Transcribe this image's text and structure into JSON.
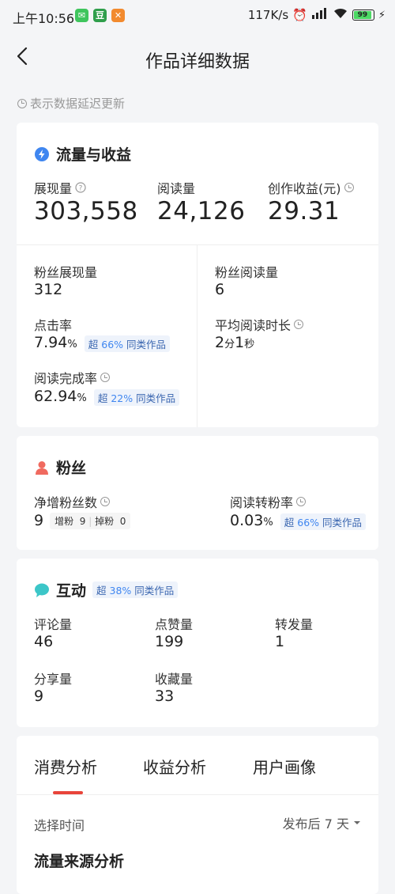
{
  "status_bar": {
    "time": "上午10:56",
    "net_speed": "117K/s",
    "battery": "99"
  },
  "nav": {
    "title": "作品详细数据"
  },
  "delay_note": "表示数据延迟更新",
  "traffic": {
    "title": "流量与收益",
    "exposure_label": "展现量",
    "exposure_value": "303,558",
    "reads_label": "阅读量",
    "reads_value": "24,126",
    "income_label": "创作收益(元)",
    "income_value": "29.31",
    "fan_exposure_label": "粉丝展现量",
    "fan_exposure_value": "312",
    "fan_reads_label": "粉丝阅读量",
    "fan_reads_value": "6",
    "ctr_label": "点击率",
    "ctr_value": "7.94",
    "ctr_unit": "%",
    "ctr_tag_pre": "超",
    "ctr_tag_pct": "66%",
    "ctr_tag_post": "同类作品",
    "avg_time_label": "平均阅读时长",
    "avg_time_min": "2",
    "avg_time_min_unit": "分",
    "avg_time_sec": "1",
    "avg_time_sec_unit": "秒",
    "completion_label": "阅读完成率",
    "completion_value": "62.94",
    "completion_unit": "%",
    "completion_tag_pre": "超",
    "completion_tag_pct": "22%",
    "completion_tag_post": "同类作品"
  },
  "fans": {
    "title": "粉丝",
    "net_label": "净增粉丝数",
    "net_value": "9",
    "gain_label": "增粉",
    "gain_value": "9",
    "lose_label": "掉粉",
    "lose_value": "0",
    "conv_label": "阅读转粉率",
    "conv_value": "0.03",
    "conv_unit": "%",
    "conv_tag_pre": "超",
    "conv_tag_pct": "66%",
    "conv_tag_post": "同类作品"
  },
  "interaction": {
    "title": "互动",
    "tag_pre": "超",
    "tag_pct": "38%",
    "tag_post": "同类作品",
    "comments_label": "评论量",
    "comments_value": "46",
    "likes_label": "点赞量",
    "likes_value": "199",
    "reposts_label": "转发量",
    "reposts_value": "1",
    "shares_label": "分享量",
    "shares_value": "9",
    "favorites_label": "收藏量",
    "favorites_value": "33"
  },
  "tabs": {
    "items": [
      "消费分析",
      "收益分析",
      "用户画像"
    ],
    "time_label": "选择时间",
    "time_value": "发布后 7 天",
    "source_title": "流量来源分析"
  },
  "colors": {
    "accent_red": "#e8443a",
    "tag_blue": "#3f86f0",
    "icon_blue": "#3f86f0",
    "icon_red": "#f06a5f",
    "icon_teal": "#3cc6c8"
  }
}
